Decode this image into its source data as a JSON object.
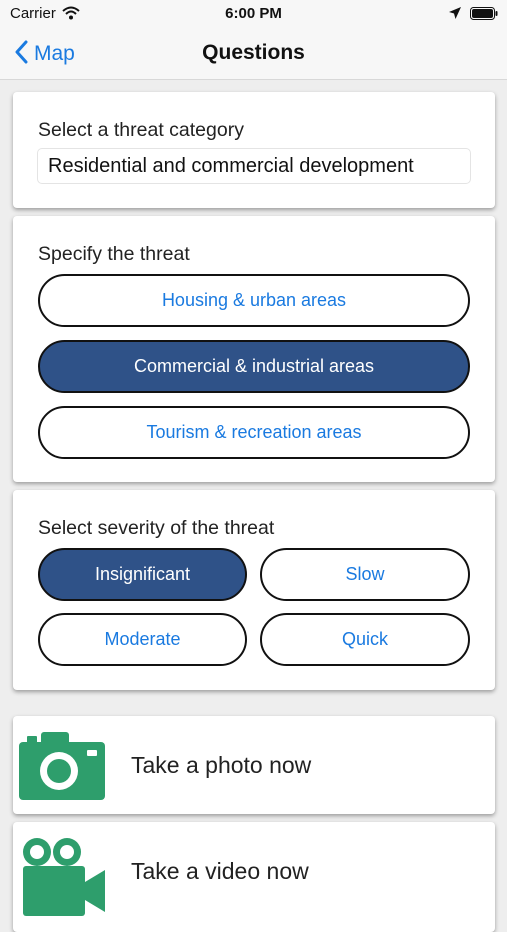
{
  "status_bar": {
    "carrier": "Carrier",
    "time": "6:00 PM"
  },
  "nav": {
    "back_label": "Map",
    "title": "Questions"
  },
  "category": {
    "label": "Select a threat category",
    "value": "Residential and commercial development"
  },
  "threat": {
    "label": "Specify the threat",
    "options": [
      {
        "label": "Housing & urban areas",
        "selected": false
      },
      {
        "label": "Commercial & industrial areas",
        "selected": true
      },
      {
        "label": "Tourism & recreation areas",
        "selected": false
      }
    ]
  },
  "severity": {
    "label": "Select severity of the threat",
    "options": [
      {
        "label": "Insignificant",
        "selected": true
      },
      {
        "label": "Slow",
        "selected": false
      },
      {
        "label": "Moderate",
        "selected": false
      },
      {
        "label": "Quick",
        "selected": false
      }
    ]
  },
  "actions": {
    "photo_label": "Take a photo now",
    "video_label": "Take a video now"
  },
  "colors": {
    "accent_blue": "#1a7ae0",
    "selected_fill": "#2f5288",
    "icon_green": "#2e9e6c"
  },
  "icons": [
    "wifi-icon",
    "location-arrow-icon",
    "battery-icon",
    "chevron-left-icon",
    "camera-icon",
    "video-camera-icon"
  ]
}
